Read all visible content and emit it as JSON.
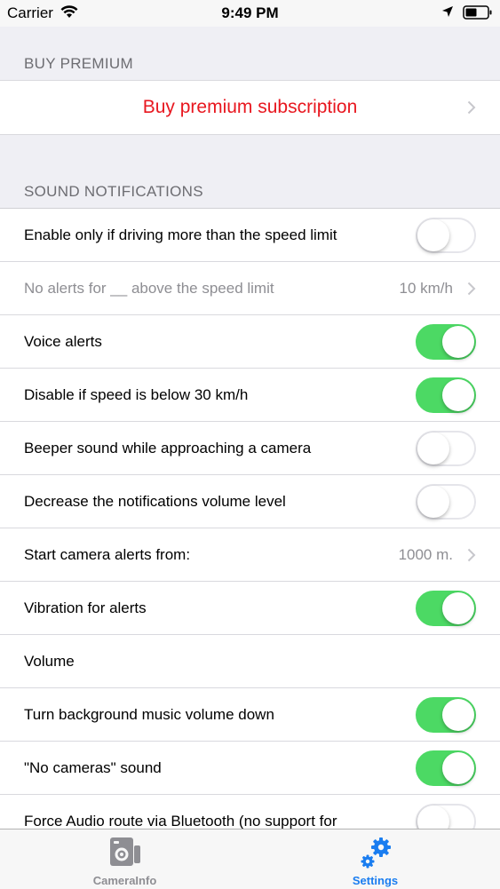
{
  "status_bar": {
    "carrier": "Carrier",
    "time": "9:49 PM"
  },
  "sections": {
    "premium": {
      "header": "BUY PREMIUM",
      "row_label": "Buy premium subscription"
    },
    "sound": {
      "header": "SOUND NOTIFICATIONS",
      "rows": [
        {
          "label": "Enable only if driving  more than the speed limit",
          "type": "toggle",
          "on": false
        },
        {
          "label": "No alerts for __ above the speed limit",
          "type": "detail",
          "detail": "10 km/h",
          "disabled": true
        },
        {
          "label": "Voice alerts",
          "type": "toggle",
          "on": true
        },
        {
          "label": "Disable if speed is below 30 km/h",
          "type": "toggle",
          "on": true
        },
        {
          "label": "Beeper sound while approaching a camera",
          "type": "toggle",
          "on": false
        },
        {
          "label": "Decrease the notifications volume level",
          "type": "toggle",
          "on": false
        },
        {
          "label": "Start camera alerts from:",
          "type": "detail",
          "detail": "1000 m."
        },
        {
          "label": "Vibration for alerts",
          "type": "toggle",
          "on": true
        },
        {
          "label": "Volume",
          "type": "plain"
        },
        {
          "label": "Turn background music volume down",
          "type": "toggle",
          "on": true
        },
        {
          "label": "\"No cameras\" sound",
          "type": "toggle",
          "on": true
        },
        {
          "label": "Force Audio route via Bluetooth (no support for",
          "type": "toggle",
          "on": false
        }
      ]
    }
  },
  "tab_bar": {
    "tabs": [
      {
        "label": "CameraInfo",
        "icon": "camera-info-icon",
        "selected": false
      },
      {
        "label": "Settings",
        "icon": "gear-icon",
        "selected": true
      }
    ]
  },
  "colors": {
    "accent": "#1a7df0",
    "premium_text": "#e8171f",
    "toggle_on": "#4cd964",
    "group_background": "#efeff4"
  }
}
